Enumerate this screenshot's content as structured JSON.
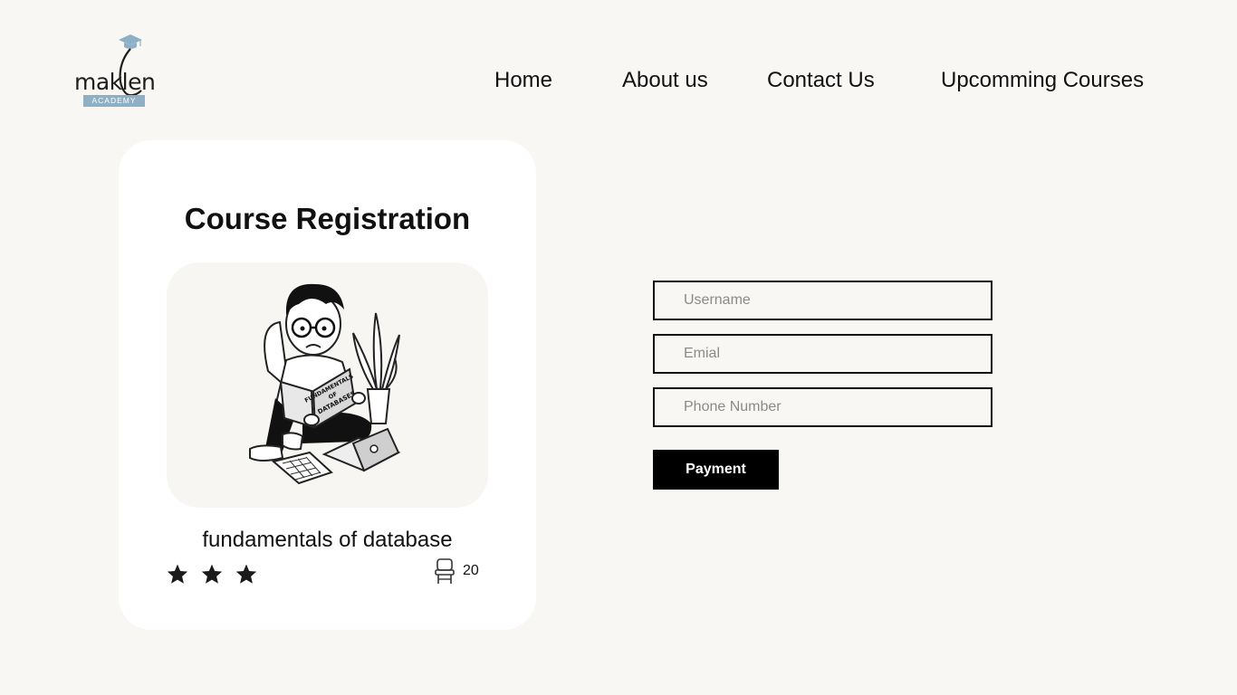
{
  "brand": {
    "name": "maklen",
    "tagline": "ACADEMY",
    "accent_color": "#8eb0c6"
  },
  "nav": {
    "items": [
      {
        "label": "Home"
      },
      {
        "label": "About us"
      },
      {
        "label": "Contact Us"
      },
      {
        "label": "Upcomming Courses"
      }
    ]
  },
  "card": {
    "title": "Course Registration",
    "course_name": "fundamentals of database",
    "book_cover_text": [
      "FUNDAMENTALS",
      "OF",
      "DATABASES"
    ],
    "rating": 3,
    "seats_icon": "chair-icon",
    "seats": "20"
  },
  "form": {
    "username_placeholder": "Username",
    "email_placeholder": "Emial",
    "phone_placeholder": "Phone Number",
    "username_value": "",
    "email_value": "",
    "phone_value": "",
    "submit_label": "Payment"
  }
}
